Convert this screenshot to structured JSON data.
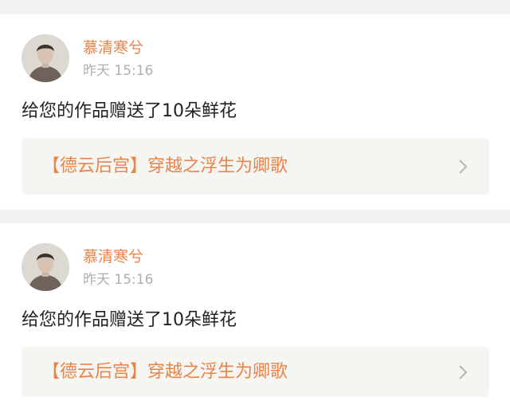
{
  "notifications": [
    {
      "username": "慕清寒兮",
      "timestamp": "昨天 15:16",
      "message": "给您的作品赠送了10朵鲜花",
      "work_title": "【德云后宫】穿越之浮生为卿歌",
      "avatar_icon": "user-portrait-icon",
      "link_icon": "chevron-right-icon"
    },
    {
      "username": "慕清寒兮",
      "timestamp": "昨天 15:16",
      "message": "给您的作品赠送了10朵鲜花",
      "work_title": "【德云后宫】穿越之浮生为卿歌",
      "avatar_icon": "user-portrait-icon",
      "link_icon": "chevron-right-icon"
    }
  ],
  "colors": {
    "accent": "#e9844a",
    "timestamp": "#b0b0b0",
    "text": "#222222",
    "link_background": "#f5f5f2",
    "page_background": "#f2f2f2",
    "card_background": "#ffffff"
  }
}
